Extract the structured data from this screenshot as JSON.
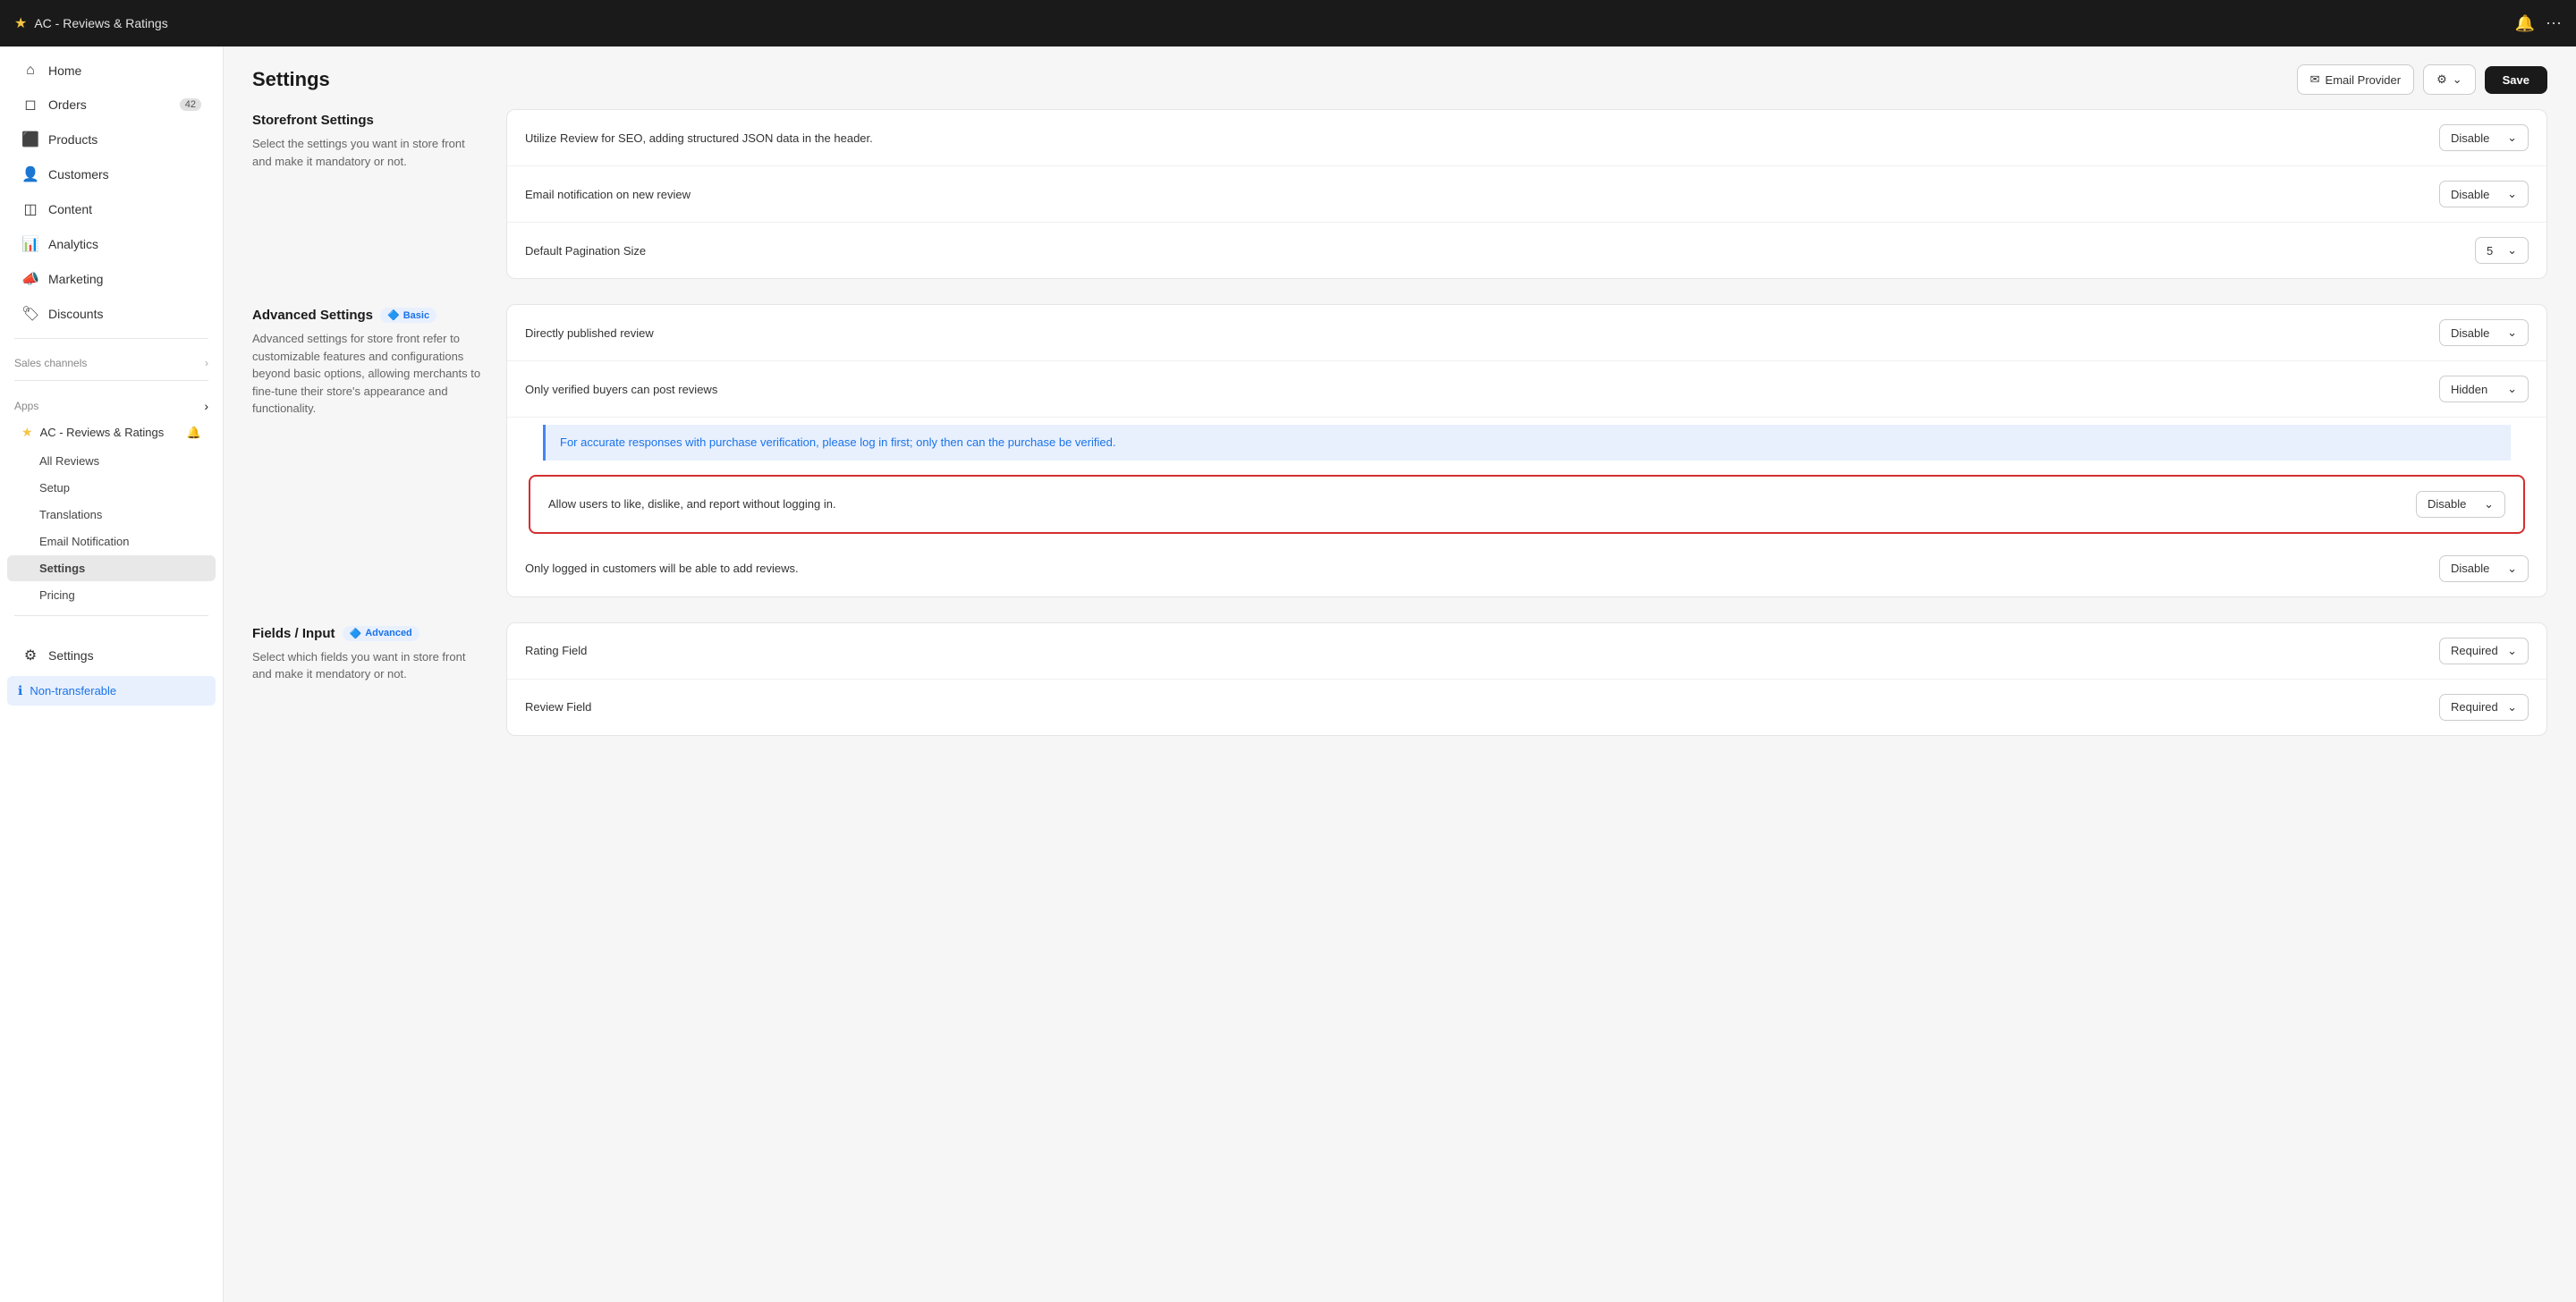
{
  "topbar": {
    "breadcrumb_star": "★",
    "breadcrumb_title": "AC - Reviews & Ratings",
    "notification_icon": "🔔",
    "more_icon": "⋯"
  },
  "sidebar": {
    "nav_items": [
      {
        "id": "home",
        "icon": "⌂",
        "label": "Home",
        "badge": null
      },
      {
        "id": "orders",
        "icon": "◻",
        "label": "Orders",
        "badge": "42"
      },
      {
        "id": "products",
        "icon": "📦",
        "label": "Products",
        "badge": null
      },
      {
        "id": "customers",
        "icon": "👤",
        "label": "Customers",
        "badge": null
      },
      {
        "id": "content",
        "icon": "◫",
        "label": "Content",
        "badge": null
      },
      {
        "id": "analytics",
        "icon": "📊",
        "label": "Analytics",
        "badge": null
      },
      {
        "id": "marketing",
        "icon": "📣",
        "label": "Marketing",
        "badge": null
      },
      {
        "id": "discounts",
        "icon": "🏷",
        "label": "Discounts",
        "badge": null
      }
    ],
    "sales_channels_label": "Sales channels",
    "apps_label": "Apps",
    "app_name": "AC - Reviews & Ratings",
    "sub_items": [
      {
        "id": "all-reviews",
        "label": "All Reviews"
      },
      {
        "id": "setup",
        "label": "Setup"
      },
      {
        "id": "translations",
        "label": "Translations"
      },
      {
        "id": "email-notification",
        "label": "Email Notification"
      },
      {
        "id": "settings",
        "label": "Settings",
        "active": true
      },
      {
        "id": "pricing",
        "label": "Pricing"
      }
    ],
    "settings_label": "Settings",
    "non_transferable_label": "Non-transferable"
  },
  "page": {
    "title": "Settings",
    "btn_email_provider": "Email Provider",
    "btn_save": "Save"
  },
  "storefront_section": {
    "title": "Storefront Settings",
    "description": "Select the settings you want in store front and make it mandatory or not.",
    "rows": [
      {
        "id": "seo",
        "label": "Utilize Review for SEO, adding structured JSON data in the header.",
        "value": "Disable"
      },
      {
        "id": "email-notif",
        "label": "Email notification on new review",
        "value": "Disable"
      },
      {
        "id": "pagination",
        "label": "Default Pagination Size",
        "value": "5"
      }
    ]
  },
  "advanced_section": {
    "title": "Advanced Settings",
    "badge": "Basic",
    "description": "Advanced settings for store front refer to customizable features and configurations beyond basic options, allowing merchants to fine-tune their store's appearance and functionality.",
    "rows": [
      {
        "id": "direct-publish",
        "label": "Directly published review",
        "value": "Disable"
      },
      {
        "id": "verified-buyers",
        "label": "Only verified buyers can post reviews",
        "value": "Hidden"
      },
      {
        "id": "allow-users",
        "label": "Allow users to like, dislike, and report without logging in.",
        "value": "Disable",
        "highlighted": true
      },
      {
        "id": "logged-in",
        "label": "Only logged in customers will be able to add reviews.",
        "value": "Disable"
      }
    ],
    "info_banner": "For accurate responses with purchase verification, please log in first; only then can the purchase be verified."
  },
  "fields_section": {
    "title": "Fields / Input",
    "badge": "Advanced",
    "description": "Select which fields you want in store front and make it mendatory or not.",
    "rows": [
      {
        "id": "rating-field",
        "label": "Rating Field",
        "value": "Required"
      },
      {
        "id": "review-field",
        "label": "Review Field",
        "value": "Required"
      }
    ]
  }
}
